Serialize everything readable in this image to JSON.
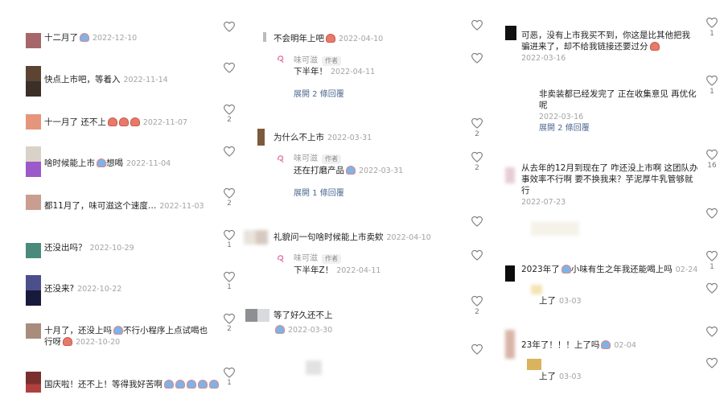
{
  "colors": {
    "date": "#a3a3a3",
    "link": "#4e6a92",
    "heart": "#8a8a8a"
  },
  "author_badge": "作者",
  "reply_author": "味可滋",
  "col1": [
    {
      "text": "十二月了",
      "emoji": "blue",
      "date": "2022-12-10",
      "likes": ""
    },
    {
      "text": "快点上市吧，等着入",
      "emoji": "",
      "date": "2022-11-14",
      "likes": ""
    },
    {
      "text": "十一月了 还不上",
      "emoji": "red3",
      "date": "2022-11-07",
      "likes": "2"
    },
    {
      "text": "啥时候能上市",
      "emoji": "blue",
      "text2": "想喝",
      "date": "2022-11-04",
      "likes": ""
    },
    {
      "text": "都11月了，味可滋这个速度…",
      "emoji": "",
      "date": "2022-11-03",
      "likes": "2"
    },
    {
      "text": "还没出吗？",
      "emoji": "",
      "date": "2022-10-29",
      "likes": "1"
    },
    {
      "text": "还没来?",
      "emoji": "",
      "date": "2022-10-22",
      "likes": "1"
    },
    {
      "text": "十月了，还没上吗",
      "emoji": "blue",
      "text2": "不行小程序上点试喝也行呀",
      "date": "2022-10-20",
      "likes": "2"
    },
    {
      "text": "国庆啦！还不上！等得我好苦啊",
      "emoji": "blue5",
      "date": "",
      "likes": "1"
    }
  ],
  "col2": {
    "c1": {
      "text": "不会明年上吧",
      "date": "2022-04-10",
      "reply": "下半年！",
      "reply_date": "2022-04-11",
      "expand": "展開 2 條回覆"
    },
    "c2": {
      "text": "为什么不上市",
      "date": "2022-03-31",
      "likes": "2",
      "reply": "还在打磨产品",
      "reply_date": "2022-03-31",
      "reply_likes": "2",
      "expand": "展開 1 條回覆"
    },
    "c3": {
      "text": "礼貌问一句啥时候能上市卖欸",
      "date": "2022-04-10",
      "reply": "下半年Z！",
      "reply_date": "2022-04-11"
    },
    "c4": {
      "text": "等了好久还不上",
      "date": "2022-03-30",
      "likes": "2"
    }
  },
  "col3": {
    "c1": {
      "text": "可恶，没有上市我买不到，你这是比其他把我骗进来了，却不给我链接还要过分",
      "date": "2022-03-16",
      "likes": "1"
    },
    "c1r": {
      "text": "非卖装都已经发完了 正在收集意见 再优化呢",
      "date": "2022-03-16",
      "likes": "1",
      "expand": "展開 2 條回覆"
    },
    "c2": {
      "text": "从去年的12月到现在了 咋还没上市啊 这团队办事效率不行啊 要不换我来？芋泥厚牛乳管够就行",
      "date": "2022-07-23",
      "likes": "16"
    },
    "c3": {
      "text": "2023年了",
      "text2": "小味有生之年我还能喝上吗",
      "date": "02-24",
      "likes": "1",
      "reply": "上了",
      "reply_date": "03-03"
    },
    "c4": {
      "text": "23年了！！！上了吗",
      "date": "02-04",
      "reply": "上了",
      "reply_date": "03-03"
    }
  }
}
